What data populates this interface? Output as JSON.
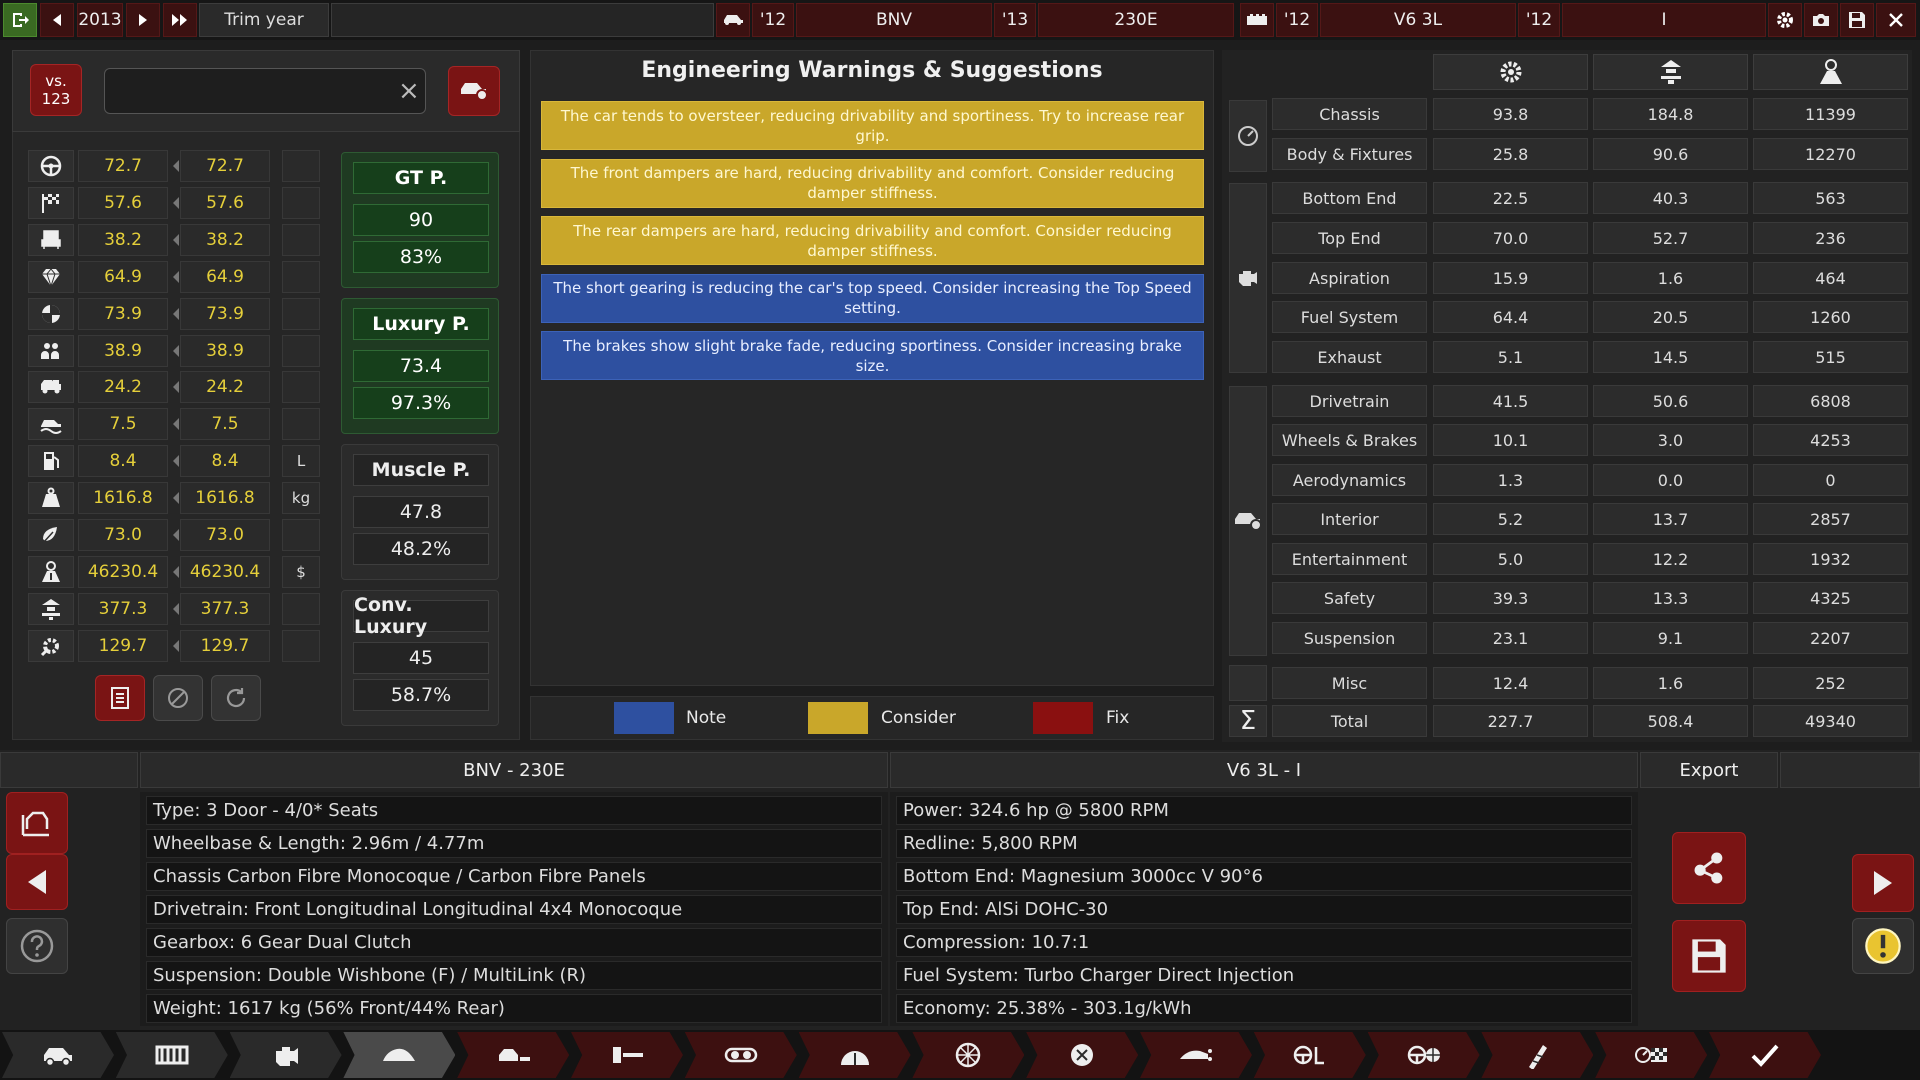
{
  "topbar": {
    "year": "2013",
    "trim_year_label": "Trim year",
    "model_year": "'12",
    "model_name": "BNV",
    "trim_year_value": "'13",
    "trim_name": "230E",
    "engine_year": "'12",
    "engine_name": "V6 3L",
    "variant_year": "'12",
    "variant_name": "I"
  },
  "compare": {
    "vs_label": "vs.\n123",
    "clear_glyph": "×"
  },
  "stats": [
    {
      "icon": "steering-wheel-icon",
      "a": "72.7",
      "b": "72.7",
      "unit": ""
    },
    {
      "icon": "checkered-flag-icon",
      "a": "57.6",
      "b": "57.6",
      "unit": ""
    },
    {
      "icon": "seat-icon",
      "a": "38.2",
      "b": "38.2",
      "unit": ""
    },
    {
      "icon": "gem-icon",
      "a": "64.9",
      "b": "64.9",
      "unit": ""
    },
    {
      "icon": "safety-icon",
      "a": "73.9",
      "b": "73.9",
      "unit": ""
    },
    {
      "icon": "passengers-icon",
      "a": "38.9",
      "b": "38.9",
      "unit": ""
    },
    {
      "icon": "cargo-icon",
      "a": "24.2",
      "b": "24.2",
      "unit": ""
    },
    {
      "icon": "offroad-icon",
      "a": "7.5",
      "b": "7.5",
      "unit": ""
    },
    {
      "icon": "fuel-icon",
      "a": "8.4",
      "b": "8.4",
      "unit": "L"
    },
    {
      "icon": "weight-icon",
      "a": "1616.8",
      "b": "1616.8",
      "unit": "kg"
    },
    {
      "icon": "environment-icon",
      "a": "73.0",
      "b": "73.0",
      "unit": ""
    },
    {
      "icon": "cost-icon",
      "a": "46230.4",
      "b": "46230.4",
      "unit": "$"
    },
    {
      "icon": "production-icon",
      "a": "377.3",
      "b": "377.3",
      "unit": ""
    },
    {
      "icon": "service-icon",
      "a": "129.7",
      "b": "129.7",
      "unit": ""
    }
  ],
  "groups": [
    {
      "label": "GT P.",
      "value": "90",
      "pct": "83%",
      "style": "green"
    },
    {
      "label": "Luxury P.",
      "value": "73.4",
      "pct": "97.3%",
      "style": "green"
    },
    {
      "label": "Muscle P.",
      "value": "47.8",
      "pct": "48.2%",
      "style": "grey"
    },
    {
      "label": "Conv. Luxury",
      "value": "45",
      "pct": "58.7%",
      "style": "grey"
    }
  ],
  "warnings": {
    "title": "Engineering Warnings & Suggestions",
    "items": [
      {
        "text": "The car tends to oversteer, reducing drivability and sportiness. Try to increase rear grip.",
        "level": "consider"
      },
      {
        "text": "The front dampers are hard, reducing drivability and comfort. Consider reducing damper stiffness.",
        "level": "consider"
      },
      {
        "text": "The rear dampers are hard, reducing drivability and comfort. Consider reducing damper stiffness.",
        "level": "consider"
      },
      {
        "text": "The short gearing is reducing the car's top speed. Consider increasing the Top Speed setting.",
        "level": "note"
      },
      {
        "text": "The brakes show slight brake fade, reducing sportiness. Consider increasing brake size.",
        "level": "note"
      }
    ],
    "legend": {
      "note": "Note",
      "consider": "Consider",
      "fix": "Fix"
    },
    "colors": {
      "note": "#2e50a0",
      "consider": "#c9a72a",
      "fix": "#8a1010"
    }
  },
  "parts": {
    "rows": [
      {
        "name": "Chassis",
        "c1": "93.8",
        "c2": "184.8",
        "c3": "11399"
      },
      {
        "name": "Body & Fixtures",
        "c1": "25.8",
        "c2": "90.6",
        "c3": "12270"
      },
      {
        "name": "Bottom End",
        "c1": "22.5",
        "c2": "40.3",
        "c3": "563"
      },
      {
        "name": "Top End",
        "c1": "70.0",
        "c2": "52.7",
        "c3": "236"
      },
      {
        "name": "Aspiration",
        "c1": "15.9",
        "c2": "1.6",
        "c3": "464"
      },
      {
        "name": "Fuel System",
        "c1": "64.4",
        "c2": "20.5",
        "c3": "1260"
      },
      {
        "name": "Exhaust",
        "c1": "5.1",
        "c2": "14.5",
        "c3": "515"
      },
      {
        "name": "Drivetrain",
        "c1": "41.5",
        "c2": "50.6",
        "c3": "6808"
      },
      {
        "name": "Wheels & Brakes",
        "c1": "10.1",
        "c2": "3.0",
        "c3": "4253"
      },
      {
        "name": "Aerodynamics",
        "c1": "1.3",
        "c2": "0.0",
        "c3": "0"
      },
      {
        "name": "Interior",
        "c1": "5.2",
        "c2": "13.7",
        "c3": "2857"
      },
      {
        "name": "Entertainment",
        "c1": "5.0",
        "c2": "12.2",
        "c3": "1932"
      },
      {
        "name": "Safety",
        "c1": "39.3",
        "c2": "13.3",
        "c3": "4325"
      },
      {
        "name": "Suspension",
        "c1": "23.1",
        "c2": "9.1",
        "c3": "2207"
      },
      {
        "name": "Misc",
        "c1": "12.4",
        "c2": "1.6",
        "c3": "252"
      },
      {
        "name": "Total",
        "c1": "227.7",
        "c2": "508.4",
        "c3": "49340"
      }
    ]
  },
  "summary": {
    "car_title": "BNV - 230E",
    "engine_title": "V6 3L - I",
    "export_label": "Export",
    "car_lines": [
      "Type: 3 Door - 4/0* Seats",
      "Wheelbase & Length: 2.96m / 4.77m",
      "Chassis Carbon Fibre Monocoque / Carbon Fibre Panels",
      "Drivetrain: Front Longitudinal Longitudinal 4x4 Monocoque",
      "Gearbox: 6 Gear Dual Clutch",
      "Suspension: Double Wishbone (F) / MultiLink (R)",
      "Weight: 1617 kg (56% Front/44% Rear)"
    ],
    "engine_lines": [
      "Power: 324.6 hp @ 5800 RPM",
      "Redline: 5,800 RPM",
      "Bottom End: Magnesium 3000cc V 90°6",
      "Top End: AlSi DOHC-30",
      "Compression: 10.7:1",
      "Fuel System: Turbo Charger Direct Injection",
      "Economy: 25.38% - 303.1g/kWh"
    ]
  },
  "tabs": [
    "car-model-tab",
    "chassis-tab",
    "engine-tab",
    "body-tab",
    "fixtures-tab",
    "interior-tab",
    "drivetrain-tab",
    "brakes-tab",
    "suspension-tab",
    "wheels-tab",
    "aero-tab",
    "tuning-tab",
    "test-tab",
    "stats-tab",
    "finish-tab",
    "confirm-tab"
  ]
}
